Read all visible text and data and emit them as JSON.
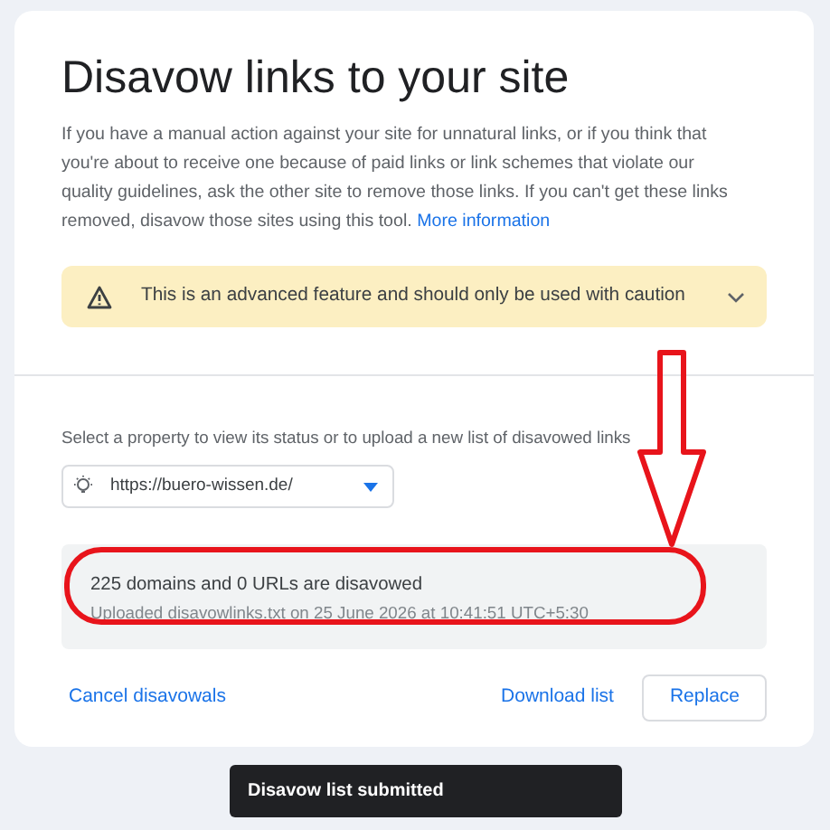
{
  "title": "Disavow links to your site",
  "description": "If you have a manual action against your site for unnatural links, or if you think that you're about to receive one because of paid links or link schemes that violate our quality guidelines, ask the other site to remove those links. If you can't get these links removed, disavow those sites using this tool.",
  "more_link": "More information",
  "warning": {
    "text": "This is an advanced feature and should only be used with caution",
    "expanded": false
  },
  "property_prompt": "Select a property to view its status or to upload a new list of disavowed links",
  "property_select": {
    "value": "https://buero-wissen.de/"
  },
  "status": {
    "headline": "225 domains and 0 URLs are disavowed",
    "detail": "Uploaded disavowlinks.txt on 25 June 2026 at 10:41:51 UTC+5:30"
  },
  "actions": {
    "cancel": "Cancel disavowals",
    "download": "Download list",
    "replace": "Replace"
  },
  "toast": "Disavow list submitted"
}
